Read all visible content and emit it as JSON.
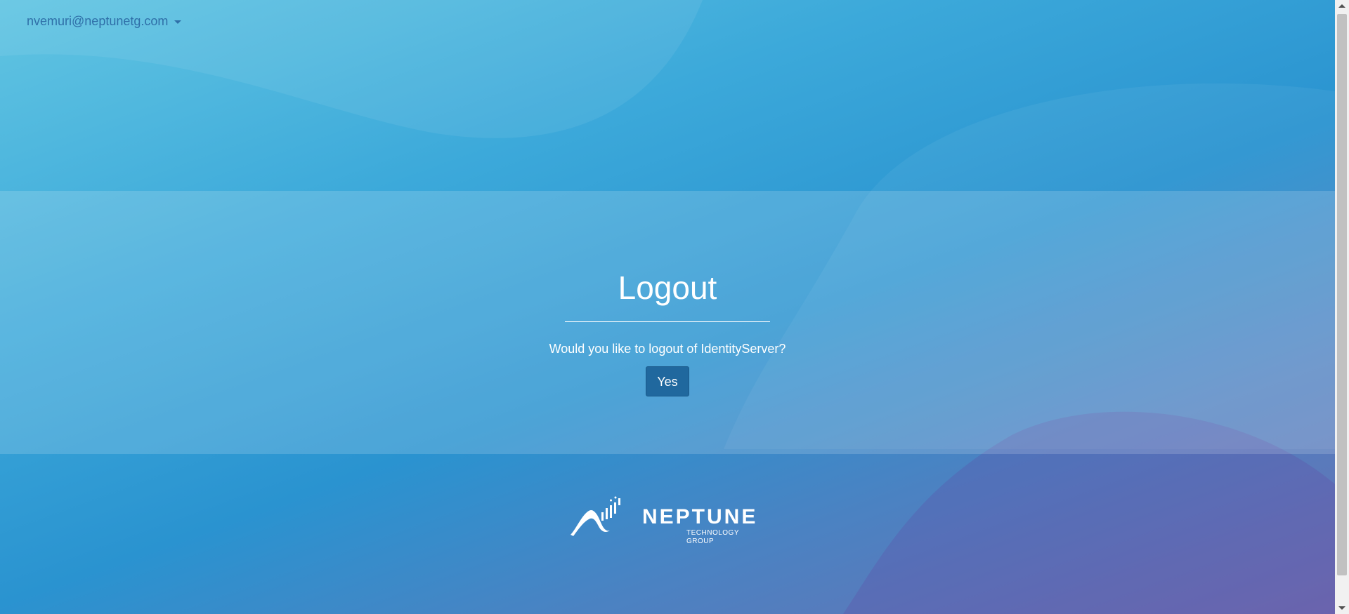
{
  "user_menu": {
    "email": "nvemuri@neptunetg.com"
  },
  "logout": {
    "title": "Logout",
    "question": "Would you like to logout of IdentityServer?",
    "yes_label": "Yes"
  },
  "logo": {
    "name": "NEPTUNE",
    "tagline": "TECHNOLOGY GROUP"
  },
  "colors": {
    "button": "#20689e",
    "user_link": "#2f6fa8",
    "text": "#ffffff"
  }
}
